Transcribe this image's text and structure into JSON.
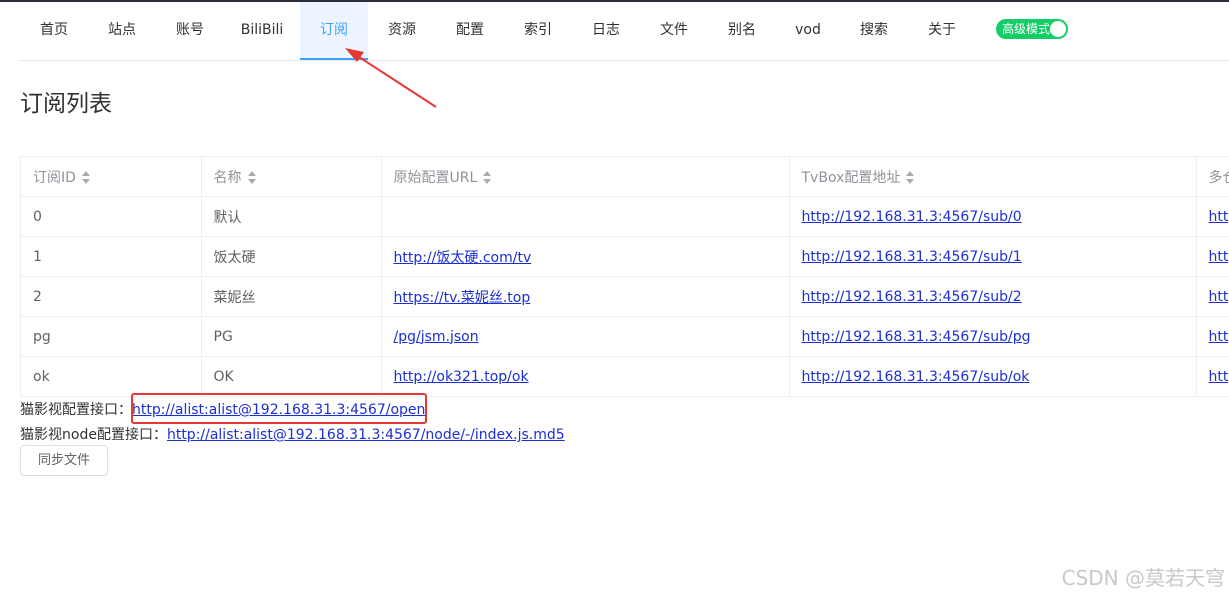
{
  "nav": {
    "items": [
      {
        "label": "首页"
      },
      {
        "label": "站点"
      },
      {
        "label": "账号"
      },
      {
        "label": "BiliBili"
      },
      {
        "label": "订阅",
        "active": true
      },
      {
        "label": "资源"
      },
      {
        "label": "配置"
      },
      {
        "label": "索引"
      },
      {
        "label": "日志"
      },
      {
        "label": "文件"
      },
      {
        "label": "别名"
      },
      {
        "label": "vod"
      },
      {
        "label": "搜索"
      },
      {
        "label": "关于"
      }
    ],
    "mode_switch": {
      "label": "高级模式",
      "on": true
    },
    "accent_color": "#409eff",
    "switch_color": "#13ce66"
  },
  "page_title": "订阅列表",
  "table": {
    "headers": [
      "订阅ID",
      "名称",
      "原始配置URL",
      "TvBox配置地址",
      "多仓"
    ],
    "rows": [
      {
        "id": "0",
        "name": "默认",
        "url": "",
        "tvbox": "http://192.168.31.3:4567/sub/0",
        "multi": "http"
      },
      {
        "id": "1",
        "name": "饭太硬",
        "url": "http://饭太硬.com/tv",
        "tvbox": "http://192.168.31.3:4567/sub/1",
        "multi": "http"
      },
      {
        "id": "2",
        "name": "菜妮丝",
        "url": "https://tv.菜妮丝.top",
        "tvbox": "http://192.168.31.3:4567/sub/2",
        "multi": "http"
      },
      {
        "id": "pg",
        "name": "PG",
        "url": "/pg/jsm.json",
        "tvbox": "http://192.168.31.3:4567/sub/pg",
        "multi": "http"
      },
      {
        "id": "ok",
        "name": "OK",
        "url": "http://ok321.top/ok",
        "tvbox": "http://192.168.31.3:4567/sub/ok",
        "multi": "http"
      }
    ]
  },
  "info": {
    "cat_label": "猫影视配置接口：",
    "cat_url": "http://alist:alist@192.168.31.3:4567/open",
    "cat_node_label": "猫影视node配置接口：",
    "cat_node_url": "http://alist:alist@192.168.31.3:4567/node/-/index.js.md5"
  },
  "sync_button": "同步文件",
  "watermark": "CSDN @莫若天穹",
  "annotation_color": "#e53935"
}
